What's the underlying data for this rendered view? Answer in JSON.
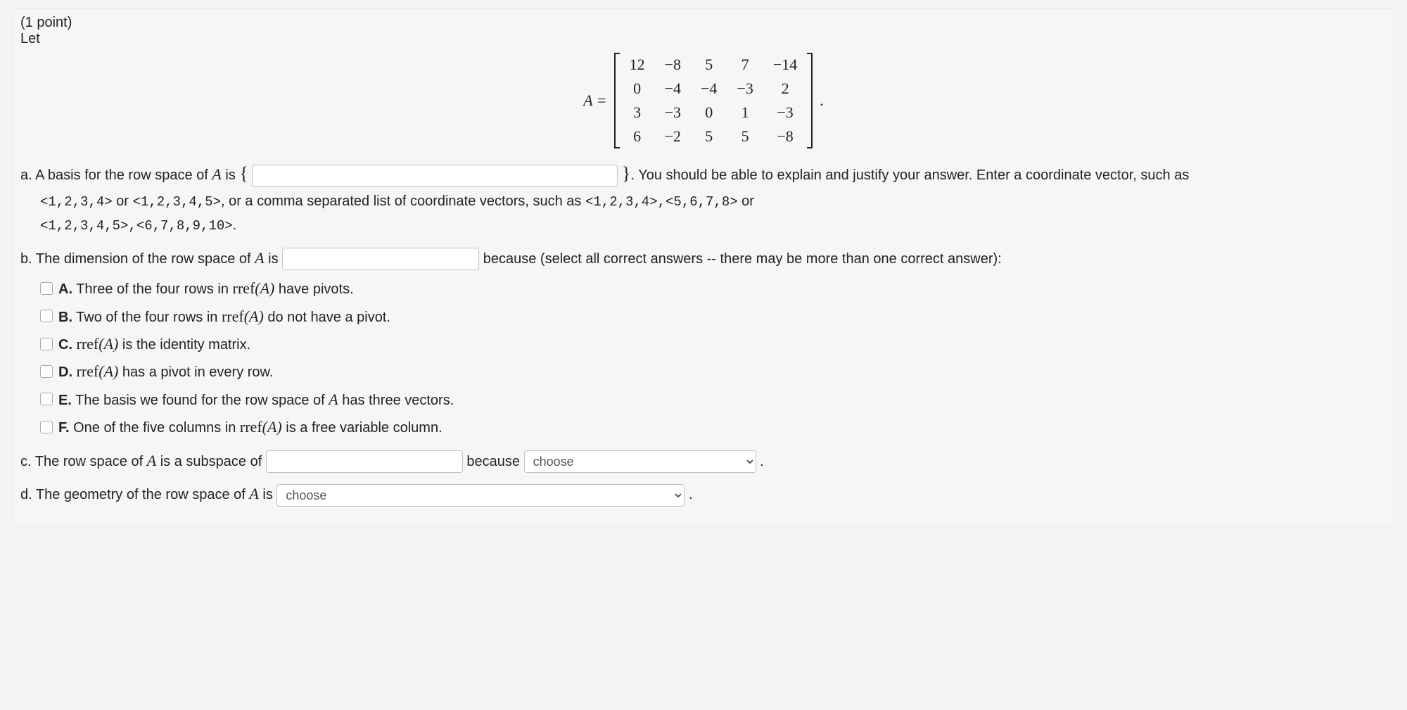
{
  "header": {
    "points": "(1 point)",
    "let": "Let"
  },
  "matrix": {
    "lhs": "A =",
    "rows": [
      [
        "12",
        "−8",
        "5",
        "7",
        "−14"
      ],
      [
        "0",
        "−4",
        "−4",
        "−3",
        "2"
      ],
      [
        "3",
        "−3",
        "0",
        "1",
        "−3"
      ],
      [
        "6",
        "−2",
        "5",
        "5",
        "−8"
      ]
    ],
    "trail": "."
  },
  "parts": {
    "a": {
      "pre": "a. A basis for the row space of ",
      "A": "A",
      "is": " is ",
      "lbrace": "{",
      "rbrace": "}",
      "after": ". You should be able to explain and justify your answer. Enter a coordinate vector, such as ",
      "ex1": "<1,2,3,4>",
      "or1": " or ",
      "ex2": "<1,2,3,4,5>",
      "mid": ", or a comma separated list of coordinate vectors, such as ",
      "ex3": "<1,2,3,4>,<5,6,7,8>",
      "or2": " or ",
      "ex4": "<1,2,3,4,5>,<6,7,8,9,10>",
      "dot": "."
    },
    "b": {
      "pre": "b. The dimension of the row space of ",
      "A": "A",
      "is": " is ",
      "because": " because (select all correct answers -- there may be more than one correct answer):",
      "options": {
        "A": {
          "bold": "A.",
          "t1": " Three of the four rows in ",
          "rr": "rref",
          "paren": "(A)",
          "t2": " have pivots."
        },
        "B": {
          "bold": "B.",
          "t1": " Two of the four rows in ",
          "rr": "rref",
          "paren": "(A)",
          "t2": " do not have a pivot."
        },
        "C": {
          "bold": "C.",
          "rr": " rref",
          "paren": "(A)",
          "t2": " is the identity matrix."
        },
        "D": {
          "bold": "D.",
          "rr": " rref",
          "paren": "(A)",
          "t2": " has a pivot in every row."
        },
        "E": {
          "bold": "E.",
          "t1": " The basis we found for the row space of ",
          "A": "A",
          "t2": " has three vectors."
        },
        "F": {
          "bold": "F.",
          "t1": " One of the five columns in ",
          "rr": "rref",
          "paren": "(A)",
          "t2": " is a free variable column."
        }
      }
    },
    "c": {
      "pre": "c. The row space of ",
      "A": "A",
      "is": " is a subspace of ",
      "because": " because ",
      "choose": "choose",
      "dot": "."
    },
    "d": {
      "pre": "d. The geometry of the row space of ",
      "A": "A",
      "is": " is ",
      "choose": "choose",
      "dot": "."
    }
  }
}
